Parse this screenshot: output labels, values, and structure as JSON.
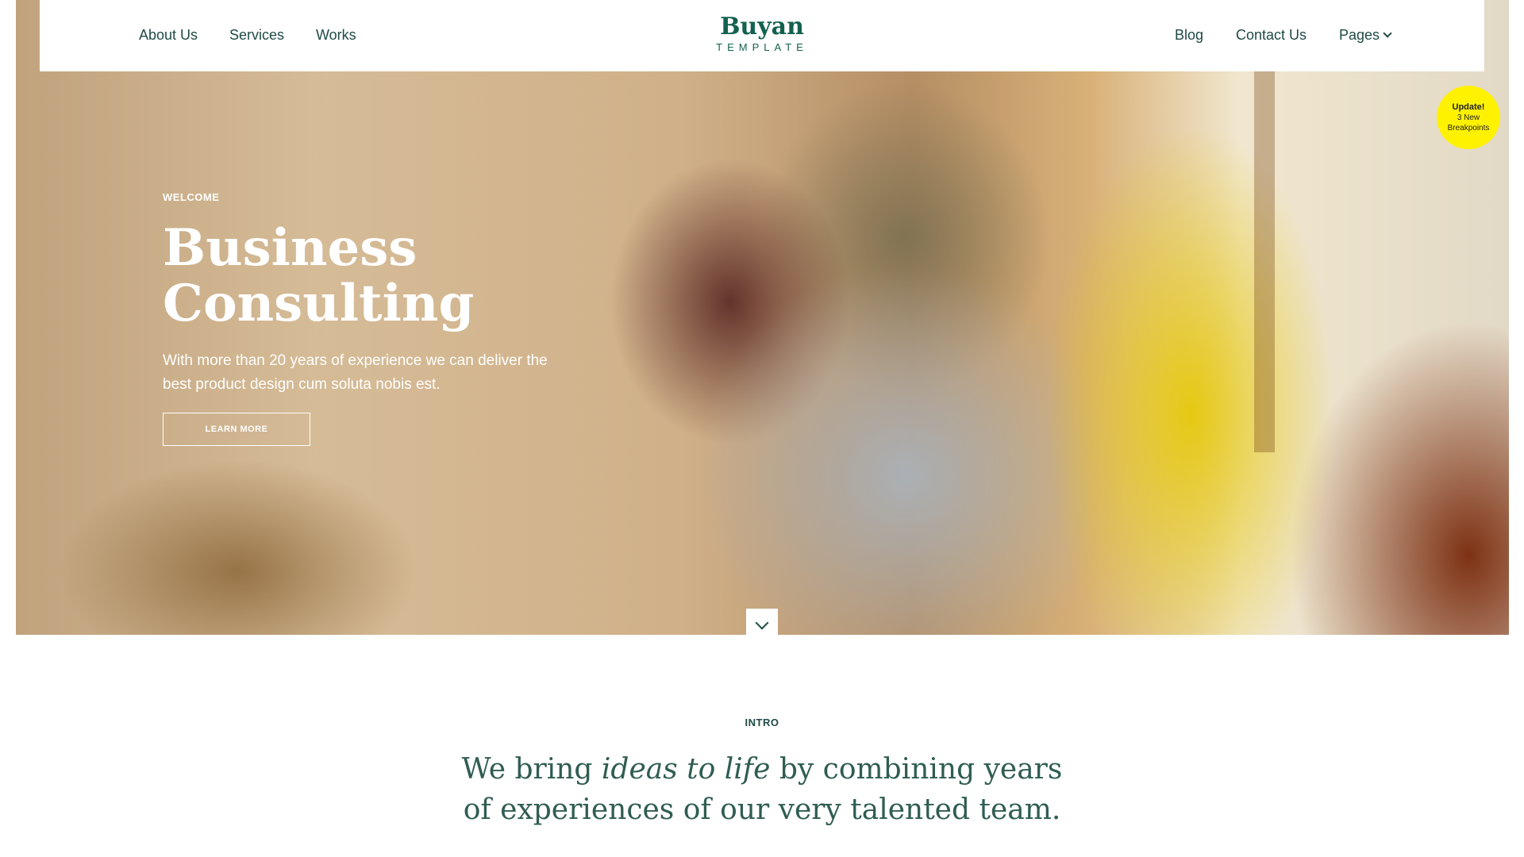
{
  "nav": {
    "left": [
      "About Us",
      "Services",
      "Works"
    ],
    "right": [
      "Blog",
      "Contact Us",
      "Pages"
    ]
  },
  "logo": {
    "main": "Buyan",
    "sub": "TEMPLATE"
  },
  "badge": {
    "title": "Update!",
    "line1": "3 New",
    "line2": "Breakpoints"
  },
  "hero": {
    "eyebrow": "WELCOME",
    "title_line1": "Business",
    "title_line2": "Consulting",
    "subtitle": "With more than 20 years of experience we can deliver the best product design cum soluta nobis est.",
    "cta": "LEARN MORE"
  },
  "intro": {
    "label": "INTRO",
    "text_before": "We bring ",
    "text_emphasis": "ideas to life",
    "text_after": " by combining years of experiences of our very talented team."
  },
  "colors": {
    "brand": "#13614f",
    "nav_text": "#1f4a44",
    "badge": "#fff200"
  },
  "icons": {
    "pages_dropdown": "chevron-down-icon",
    "scroll": "chevron-down-icon"
  }
}
